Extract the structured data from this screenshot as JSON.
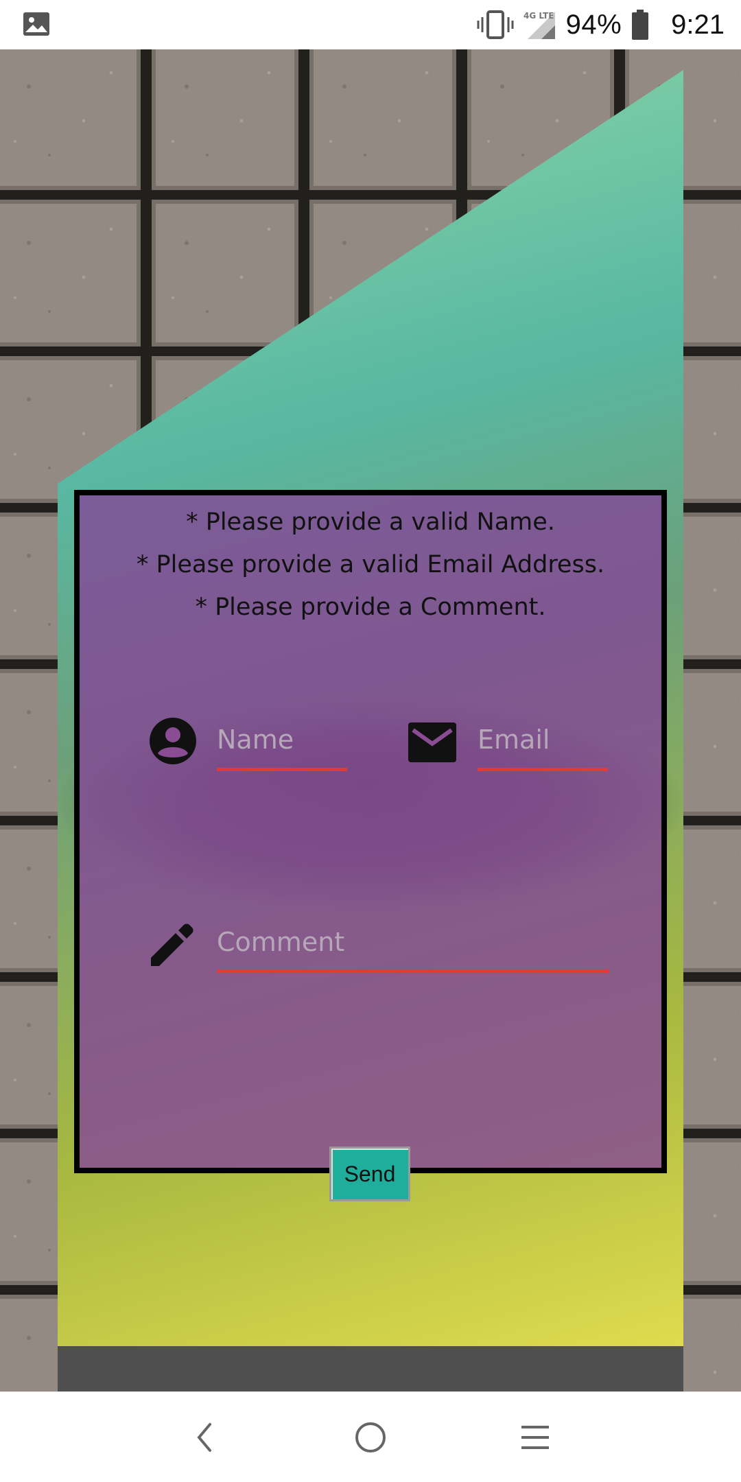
{
  "status_bar": {
    "notification_icon": "image-icon",
    "vibrate_icon": "vibrate-icon",
    "network_label": "4G LTE",
    "signal_icon": "signal-icon",
    "battery_percent": "94%",
    "battery_icon": "battery-icon",
    "time": "9:21"
  },
  "form": {
    "errors": [
      "* Please provide a valid Name.",
      "* Please provide a valid Email Address.",
      "* Please provide a Comment."
    ],
    "name": {
      "icon": "account-circle-icon",
      "placeholder": "Name",
      "value": ""
    },
    "email": {
      "icon": "mail-icon",
      "placeholder": "Email",
      "value": ""
    },
    "comment": {
      "icon": "pencil-icon",
      "placeholder": "Comment",
      "value": ""
    },
    "send_label": "Send"
  },
  "colors": {
    "card_overlay": "#8a4a96",
    "underline": "#e23a3a",
    "send_button": "#1fae9c",
    "footer": "#4f4f4f"
  },
  "nav_bar": {
    "back_icon": "chevron-left-icon",
    "home_icon": "circle-home-icon",
    "menu_icon": "menu-lines-icon"
  }
}
